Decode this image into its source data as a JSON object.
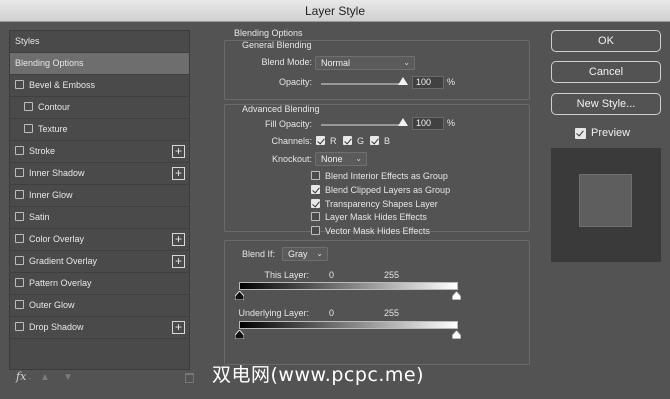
{
  "window": {
    "title": "Layer Style"
  },
  "styles_panel": {
    "items": [
      {
        "label": "Styles",
        "checkbox": false,
        "plus": false,
        "indent": false,
        "selected": false
      },
      {
        "label": "Blending Options",
        "checkbox": false,
        "plus": false,
        "indent": false,
        "selected": true
      },
      {
        "label": "Bevel & Emboss",
        "checkbox": true,
        "plus": false,
        "indent": false,
        "selected": false
      },
      {
        "label": "Contour",
        "checkbox": true,
        "plus": false,
        "indent": true,
        "selected": false
      },
      {
        "label": "Texture",
        "checkbox": true,
        "plus": false,
        "indent": true,
        "selected": false
      },
      {
        "label": "Stroke",
        "checkbox": true,
        "plus": true,
        "indent": false,
        "selected": false
      },
      {
        "label": "Inner Shadow",
        "checkbox": true,
        "plus": true,
        "indent": false,
        "selected": false
      },
      {
        "label": "Inner Glow",
        "checkbox": true,
        "plus": false,
        "indent": false,
        "selected": false
      },
      {
        "label": "Satin",
        "checkbox": true,
        "plus": false,
        "indent": false,
        "selected": false
      },
      {
        "label": "Color Overlay",
        "checkbox": true,
        "plus": true,
        "indent": false,
        "selected": false
      },
      {
        "label": "Gradient Overlay",
        "checkbox": true,
        "plus": true,
        "indent": false,
        "selected": false
      },
      {
        "label": "Pattern Overlay",
        "checkbox": true,
        "plus": false,
        "indent": false,
        "selected": false
      },
      {
        "label": "Outer Glow",
        "checkbox": true,
        "plus": false,
        "indent": false,
        "selected": false
      },
      {
        "label": "Drop Shadow",
        "checkbox": true,
        "plus": true,
        "indent": false,
        "selected": false
      }
    ],
    "footer": {
      "fx_label": "fx",
      "fx_dot": "."
    }
  },
  "blending": {
    "section_title": "Blending Options",
    "general": {
      "title": "General Blending",
      "blend_mode_label": "Blend Mode:",
      "blend_mode_value": "Normal",
      "opacity_label": "Opacity:",
      "opacity_value": "100",
      "opacity_unit": "%",
      "opacity_fraction": 1.0
    },
    "advanced": {
      "title": "Advanced Blending",
      "fill_opacity_label": "Fill Opacity:",
      "fill_opacity_value": "100",
      "fill_opacity_unit": "%",
      "fill_opacity_fraction": 1.0,
      "channels_label": "Channels:",
      "channels": [
        {
          "label": "R",
          "checked": true
        },
        {
          "label": "G",
          "checked": true
        },
        {
          "label": "B",
          "checked": true
        }
      ],
      "knockout_label": "Knockout:",
      "knockout_value": "None",
      "options": [
        {
          "label": "Blend Interior Effects as Group",
          "checked": false
        },
        {
          "label": "Blend Clipped Layers as Group",
          "checked": true
        },
        {
          "label": "Transparency Shapes Layer",
          "checked": true
        },
        {
          "label": "Layer Mask Hides Effects",
          "checked": false
        },
        {
          "label": "Vector Mask Hides Effects",
          "checked": false
        }
      ]
    },
    "blend_if": {
      "label": "Blend If:",
      "value": "Gray",
      "this_layer_label": "This Layer:",
      "this_layer_min": "0",
      "this_layer_max": "255",
      "underlying_label": "Underlying Layer:",
      "underlying_min": "0",
      "underlying_max": "255"
    }
  },
  "buttons": {
    "ok": "OK",
    "cancel": "Cancel",
    "new_style": "New Style...",
    "preview_label": "Preview",
    "preview_checked": true
  },
  "watermark": "双电网(www.pcpc.me)",
  "colors": {
    "background": "#535353",
    "panel": "#4a4a4a",
    "selected_row": "#6e6e6e"
  }
}
